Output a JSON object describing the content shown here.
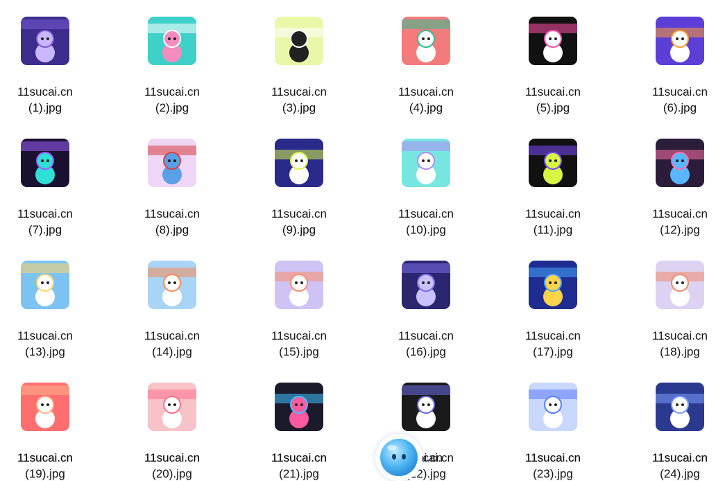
{
  "colors": {
    "text": "#111111",
    "background": "#ffffff",
    "assistant_bubble": "#4fb6f2"
  },
  "files": [
    {
      "name": "11sucai.cn\n(1).jpg",
      "thumb_colors": [
        "#3c2d8c",
        "#7a5ad6",
        "#c9b8ff"
      ],
      "thumb_icon": "robot-figure-icon"
    },
    {
      "name": "11sucai.cn\n(2).jpg",
      "thumb_colors": [
        "#3fd0c9",
        "#ffffff",
        "#f58cc0"
      ],
      "thumb_icon": "girl-figure-icon"
    },
    {
      "name": "11sucai.cn\n(3).jpg",
      "thumb_colors": [
        "#e9f7a8",
        "#ffffff",
        "#222222"
      ],
      "thumb_icon": "girl-figure-icon"
    },
    {
      "name": "11sucai.cn\n(4).jpg",
      "thumb_colors": [
        "#f47b7b",
        "#2fbf8f",
        "#ffffff"
      ],
      "thumb_icon": "panda-figure-icon"
    },
    {
      "name": "11sucai.cn\n(5).jpg",
      "thumb_colors": [
        "#111111",
        "#ff4fa8",
        "#ffffff"
      ],
      "thumb_icon": "figure-icon"
    },
    {
      "name": "11sucai.cn\n(6).jpg",
      "thumb_colors": [
        "#5b3fd6",
        "#ff9d2e",
        "#ffffff"
      ],
      "thumb_icon": "snowman-figure-icon"
    },
    {
      "name": "11sucai.cn\n(7).jpg",
      "thumb_colors": [
        "#1a1030",
        "#a05cff",
        "#2ee0d8"
      ],
      "thumb_icon": "astronaut-figure-icon"
    },
    {
      "name": "11sucai.cn\n(8).jpg",
      "thumb_colors": [
        "#f0d6f6",
        "#d94040",
        "#5aa0e8"
      ],
      "thumb_icon": "figure-icon"
    },
    {
      "name": "11sucai.cn\n(9).jpg",
      "thumb_colors": [
        "#2a2a8a",
        "#d7f542",
        "#ffffff"
      ],
      "thumb_icon": "figure-icon"
    },
    {
      "name": "11sucai.cn\n(10).jpg",
      "thumb_colors": [
        "#77e6e0",
        "#b28cf7",
        "#ffffff"
      ],
      "thumb_icon": "figure-icon"
    },
    {
      "name": "11sucai.cn\n(11).jpg",
      "thumb_colors": [
        "#111111",
        "#7a4bff",
        "#d7f542"
      ],
      "thumb_icon": "figure-icon"
    },
    {
      "name": "11sucai.cn\n(12).jpg",
      "thumb_colors": [
        "#2b1d3a",
        "#ff6fa8",
        "#5ab6ff"
      ],
      "thumb_icon": "astronaut-figure-icon"
    },
    {
      "name": "11sucai.cn\n(13).jpg",
      "thumb_colors": [
        "#7cc3f2",
        "#ffd36a",
        "#ffffff"
      ],
      "thumb_icon": "astronaut-figure-icon"
    },
    {
      "name": "11sucai.cn\n(14).jpg",
      "thumb_colors": [
        "#a9d4f5",
        "#f58a5a",
        "#ffffff"
      ],
      "thumb_icon": "astronaut-figure-icon"
    },
    {
      "name": "11sucai.cn\n(15).jpg",
      "thumb_colors": [
        "#cfc2f5",
        "#ff8f6a",
        "#ffffff"
      ],
      "thumb_icon": "astronaut-figure-icon"
    },
    {
      "name": "11sucai.cn\n(16).jpg",
      "thumb_colors": [
        "#2a2670",
        "#7a6ce8",
        "#c9c2ff"
      ],
      "thumb_icon": "robot-figure-icon"
    },
    {
      "name": "11sucai.cn\n(17).jpg",
      "thumb_colors": [
        "#1e2d8f",
        "#49a6ff",
        "#ffd34a"
      ],
      "thumb_icon": "astronaut-figure-icon"
    },
    {
      "name": "11sucai.cn\n(18).jpg",
      "thumb_colors": [
        "#ddd2f2",
        "#f08a6a",
        "#ffffff"
      ],
      "thumb_icon": "astronaut-figure-icon"
    },
    {
      "name": "11sucai.cn\n(19).jpg",
      "thumb_colors": [
        "#ff6f6f",
        "#ffb38a",
        "#ffffff"
      ],
      "thumb_icon": "figure-icon"
    },
    {
      "name": "11sucai.cn\n(20).jpg",
      "thumb_colors": [
        "#f7c3c9",
        "#ff6f8a",
        "#ffffff"
      ],
      "thumb_icon": "bear-figure-icon"
    },
    {
      "name": "11sucai.cn\n(21).jpg",
      "thumb_colors": [
        "#1a1a2a",
        "#3fc1ff",
        "#ff5aa0"
      ],
      "thumb_icon": "figure-icon"
    },
    {
      "name": "11sucai.cn\n(22).jpg",
      "thumb_colors": [
        "#1a1a1a",
        "#6b6be8",
        "#ffffff"
      ],
      "thumb_icon": "robot-figure-icon"
    },
    {
      "name": "11sucai.cn\n(23).jpg",
      "thumb_colors": [
        "#c9d8ff",
        "#5b7cff",
        "#ffffff"
      ],
      "thumb_icon": "penguin-figure-icon"
    },
    {
      "name": "11sucai.cn\n(24).jpg",
      "thumb_colors": [
        "#2b3a8f",
        "#7a9cff",
        "#ffffff"
      ],
      "thumb_icon": "figure-icon"
    }
  ],
  "partial_labels": [
    {
      "text": "11sucai.cn",
      "col": 0
    },
    {
      "text": "11sucai.cn",
      "col": 1
    },
    {
      "text": "11sucai.cn",
      "col": 2
    },
    {
      "text": "icai.cn",
      "col": 3
    },
    {
      "text": "11sucai.cn",
      "col": 4
    },
    {
      "text": "11sucai.cn",
      "col": 5
    }
  ],
  "assistant": {
    "icon": "blue-blob-assistant-icon"
  }
}
